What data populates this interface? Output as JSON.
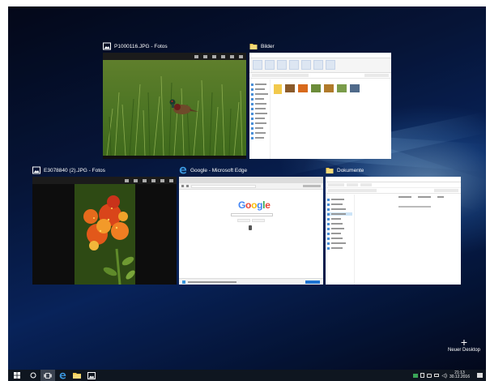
{
  "windows": [
    {
      "id": "photo1",
      "title": "P1000116.JPG - Fotos",
      "icon": "photos-icon"
    },
    {
      "id": "explorer-bilder",
      "title": "Bilder",
      "icon": "folder-icon"
    },
    {
      "id": "photo2",
      "title": "E3078840 (2).JPG - Fotos",
      "icon": "photos-icon"
    },
    {
      "id": "edge",
      "title": "Google - Microsoft Edge",
      "icon": "edge-icon"
    },
    {
      "id": "explorer-dokumente",
      "title": "Dokumente",
      "icon": "folder-icon"
    }
  ],
  "google": {
    "logo": "Google"
  },
  "new_desktop": {
    "label": "Neuer Desktop",
    "icon": "plus-icon"
  },
  "taskbar": {
    "items": [
      {
        "name": "start-icon"
      },
      {
        "name": "cortana-icon"
      },
      {
        "name": "task-view-icon",
        "active": true
      },
      {
        "name": "edge-icon"
      },
      {
        "name": "file-explorer-icon"
      },
      {
        "name": "photos-icon"
      }
    ],
    "clock_time": "21:13",
    "clock_date": "30.12.2016"
  },
  "colors": {
    "accent": "#1e73d2",
    "taskbar": "#0f1620",
    "desktop": "#0a2b6e"
  }
}
